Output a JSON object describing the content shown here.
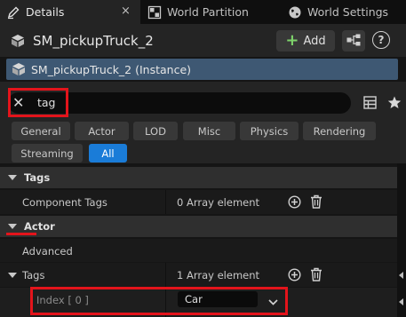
{
  "tabs": [
    {
      "label": "Details",
      "icon": "pencil-icon"
    },
    {
      "label": "World Partition",
      "icon": "grid-icon"
    },
    {
      "label": "World Settings",
      "icon": "globe-icon"
    }
  ],
  "tab_close_glyph": "×",
  "header": {
    "actor_name": "SM_pickupTruck_2",
    "add_label": "Add",
    "add_glyph": "+",
    "help_glyph": "?"
  },
  "instance_label": "SM_pickupTruck_2 (Instance)",
  "search": {
    "value": "tag",
    "clear_glyph": "✕"
  },
  "filters": [
    "General",
    "Actor",
    "LOD",
    "Misc",
    "Physics",
    "Rendering",
    "Streaming",
    "All"
  ],
  "selected_filter": "All",
  "sections": {
    "tags": {
      "title": "Tags",
      "component_tags_label": "Component Tags",
      "component_tags_value": "0 Array element"
    },
    "actor": {
      "title": "Actor",
      "advanced_label": "Advanced",
      "tags_label": "Tags",
      "tags_value": "1 Array element",
      "index_label": "Index [ 0 ]",
      "index_value": "Car"
    }
  },
  "colors": {
    "accent_blue": "#1a7cd8",
    "highlight_red": "#e3141b",
    "instance_bar": "#3e5873",
    "add_green": "#7ed36b"
  }
}
